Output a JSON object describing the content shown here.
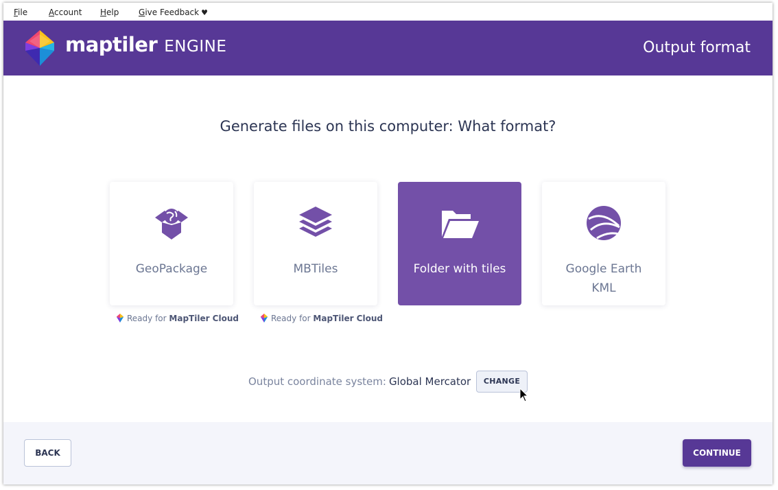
{
  "menu": {
    "file_ul": "F",
    "file_rest": "ile",
    "account_ul": "A",
    "account_rest": "ccount",
    "help_ul": "H",
    "help_rest": "elp",
    "feedback_ul": "G",
    "feedback_rest": "ive Feedback",
    "feedback_icon": "heart-icon"
  },
  "header": {
    "brand_main": "maptiler",
    "brand_sub": "ENGINE",
    "title": "Output format",
    "color": "#573896"
  },
  "main": {
    "question": "Generate files on this computer: What format?",
    "formats": [
      {
        "label": "GeoPackage",
        "icon": "open-box-globe-icon",
        "selected": false,
        "note_prefix": "Ready for",
        "note_brand": "MapTiler Cloud"
      },
      {
        "label": "MBTiles",
        "icon": "layers-icon",
        "selected": false,
        "note_prefix": "Ready for",
        "note_brand": "MapTiler Cloud"
      },
      {
        "label": "Folder with tiles",
        "icon": "folder-open-icon",
        "selected": true
      },
      {
        "label": "Google Earth KML",
        "icon": "google-earth-icon",
        "selected": false
      }
    ],
    "coord_label": "Output coordinate system:",
    "coord_value": "Global Mercator",
    "change_label": "CHANGE",
    "accent": "#7350a8"
  },
  "footer": {
    "back_label": "BACK",
    "continue_label": "CONTINUE"
  }
}
